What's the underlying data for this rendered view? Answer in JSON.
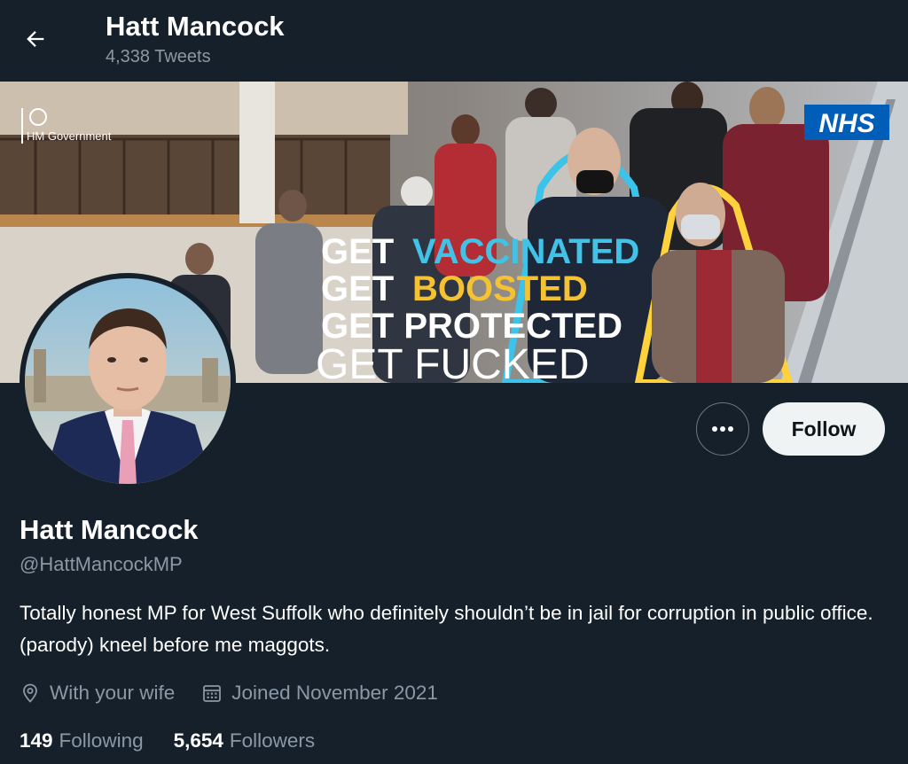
{
  "header": {
    "title": "Hatt Mancock",
    "tweet_count": "4,338 Tweets",
    "back_icon": "arrow-left-icon"
  },
  "banner": {
    "gov_label": "HM Government",
    "nhs_label": "NHS",
    "lines": [
      "GET",
      "VACCINATED",
      "GET",
      "BOOSTED",
      "GET PROTECTED",
      "GET FUCKED"
    ],
    "colors": {
      "vaccinated": "#42c2e6",
      "boosted": "#f5c231",
      "outline_blue": "#3cc3ea",
      "outline_yellow": "#ffd23c",
      "nhs_blue": "#005eb8"
    }
  },
  "profile": {
    "name": "Hatt Mancock",
    "handle": "@HattMancockMP",
    "bio": "Totally honest MP for West Suffolk who definitely shouldn’t be in jail for corruption in public office.(parody) kneel before me maggots.",
    "location": "With your wife",
    "joined": "Joined November 2021",
    "following_count": "149",
    "following_label": "Following",
    "followers_count": "5,654",
    "followers_label": "Followers"
  },
  "actions": {
    "follow_label": "Follow",
    "more_icon": "more-horizontal-icon"
  },
  "theme": {
    "background": "#15202b",
    "secondary_text": "#8b98a5",
    "button_bg": "#eff3f4"
  }
}
